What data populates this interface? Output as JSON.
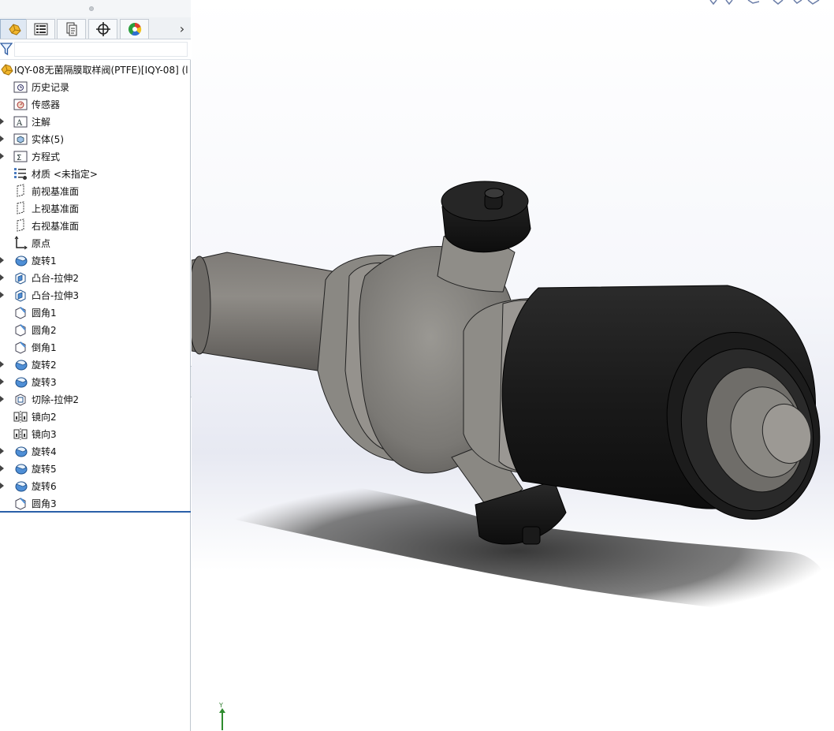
{
  "panel": {
    "tabs": [
      {
        "name": "feature-manager",
        "icon": "feature-manager-icon"
      },
      {
        "name": "property-manager",
        "icon": "property-manager-icon"
      },
      {
        "name": "configuration-manager",
        "icon": "configuration-manager-icon"
      },
      {
        "name": "dimxpert-manager",
        "icon": "dimxpert-icon"
      },
      {
        "name": "display-manager",
        "icon": "display-manager-icon"
      }
    ],
    "root_label": "IQY-08无菌隔膜取样阀(PTFE)[IQY-08]  (l",
    "items": [
      {
        "label": "历史记录",
        "icon": "history-folder-icon",
        "expandable": false
      },
      {
        "label": "传感器",
        "icon": "sensor-folder-icon",
        "expandable": false
      },
      {
        "label": "注解",
        "icon": "annotation-folder-icon",
        "expandable": true
      },
      {
        "label": "实体(5)",
        "icon": "solid-bodies-folder-icon",
        "expandable": true
      },
      {
        "label": "方程式",
        "icon": "equations-folder-icon",
        "expandable": true
      },
      {
        "label": "材质 <未指定>",
        "icon": "material-icon",
        "expandable": false
      },
      {
        "label": "前视基准面",
        "icon": "plane-icon",
        "expandable": false
      },
      {
        "label": "上视基准面",
        "icon": "plane-icon",
        "expandable": false
      },
      {
        "label": "右视基准面",
        "icon": "plane-icon",
        "expandable": false
      },
      {
        "label": "原点",
        "icon": "origin-icon",
        "expandable": false
      },
      {
        "label": "旋转1",
        "icon": "revolve-icon",
        "expandable": true
      },
      {
        "label": "凸台-拉伸2",
        "icon": "boss-extrude-icon",
        "expandable": true
      },
      {
        "label": "凸台-拉伸3",
        "icon": "boss-extrude-icon",
        "expandable": true
      },
      {
        "label": "圆角1",
        "icon": "fillet-icon",
        "expandable": false
      },
      {
        "label": "圆角2",
        "icon": "fillet-icon",
        "expandable": false
      },
      {
        "label": "倒角1",
        "icon": "chamfer-icon",
        "expandable": false
      },
      {
        "label": "旋转2",
        "icon": "revolve-icon",
        "expandable": true
      },
      {
        "label": "旋转3",
        "icon": "revolve-icon",
        "expandable": true
      },
      {
        "label": "切除-拉伸2",
        "icon": "cut-extrude-icon",
        "expandable": true
      },
      {
        "label": "镜向2",
        "icon": "mirror-icon",
        "expandable": false
      },
      {
        "label": "镜向3",
        "icon": "mirror-icon",
        "expandable": false
      },
      {
        "label": "旋转4",
        "icon": "revolve-icon",
        "expandable": true
      },
      {
        "label": "旋转5",
        "icon": "revolve-icon",
        "expandable": true
      },
      {
        "label": "旋转6",
        "icon": "revolve-icon",
        "expandable": true
      },
      {
        "label": "圆角3",
        "icon": "fillet-icon",
        "expandable": false
      }
    ]
  },
  "viewport": {
    "model": "sampling-valve-3d-model",
    "triad_axis_label": "Y"
  },
  "colors": {
    "accent": "#2a5fa8",
    "metal": "#8a8883",
    "rubber": "#1b1b1b"
  }
}
